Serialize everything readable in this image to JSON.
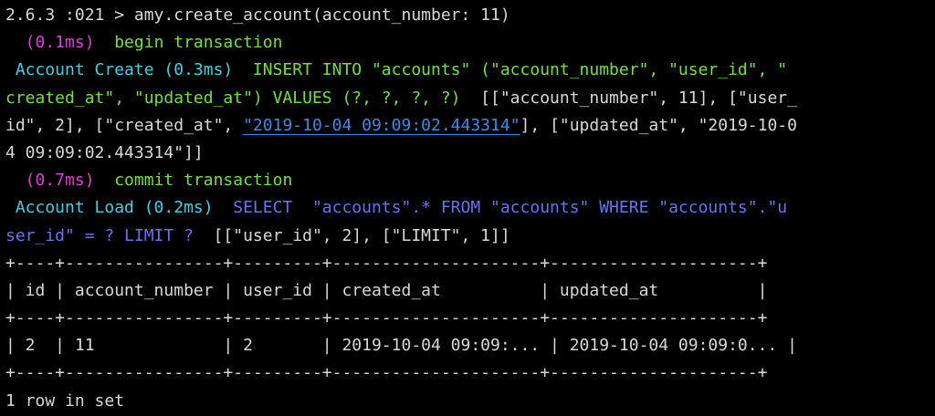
{
  "terminal": {
    "prompt": "2.6.3 :021 > amy.create_account(account_number: 11)",
    "begin": {
      "time": "  (0.1ms)",
      "sql": "  begin transaction"
    },
    "insert": {
      "label": " Account Create (0.3ms)",
      "sql_line1": "  INSERT INTO \"accounts\" (\"account_number\", \"user_id\", \"",
      "sql_line2_start": "created_at\", \"updated_at\") VALUES (?, ?, ?, ?)",
      "binds_line2_end": "  [[\"account_number\", 11], [\"user_",
      "binds_line3_start": "id\", 2], [\"created_at\", ",
      "binds_line3_link": "\"2019-10-04 09:09:02.443314\"",
      "binds_line3_end": "], [\"updated_at\", \"2019-10-0",
      "binds_line4": "4 09:09:02.443314\"]]"
    },
    "commit": {
      "time": "  (0.7ms)",
      "sql": "  commit transaction"
    },
    "select": {
      "label": " Account Load (0.2ms)",
      "sql_line1": "  SELECT  \"accounts\".* FROM \"accounts\" WHERE \"accounts\".\"u",
      "sql_line2": "ser_id\" = ? LIMIT ?",
      "binds": "  [[\"user_id\", 2], [\"LIMIT\", 1]]"
    },
    "table": {
      "border_top": "+----+----------------+---------+---------------------+---------------------+",
      "header_row": "| id | account_number | user_id | created_at          | updated_at          |",
      "border_mid": "+----+----------------+---------+---------------------+---------------------+",
      "data_row": "| 2  | 11             | 2       | 2019-10-04 09:09:... | 2019-10-04 09:09:0... |",
      "border_bottom": "+----+----------------+---------+---------------------+---------------------+"
    },
    "footer": "1 row in set"
  },
  "colors": {
    "background": "#000000",
    "text": "#d8d8d8",
    "magenta": "#e23bd4",
    "cyan": "#3fd1e6",
    "green": "#71e23d",
    "blue": "#6e6ff5",
    "link": "#3e8ae6"
  }
}
